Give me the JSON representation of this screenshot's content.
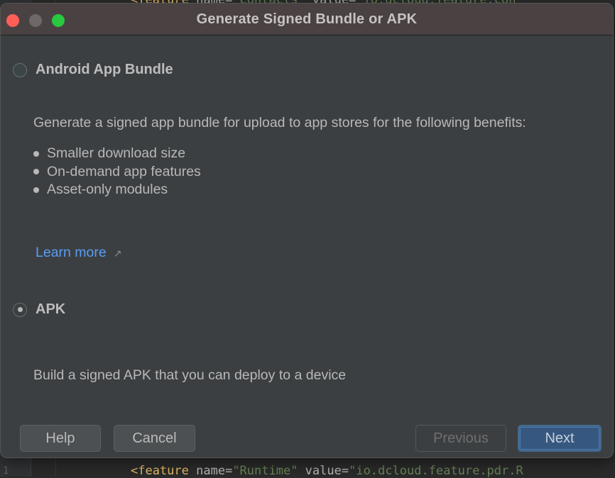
{
  "background_editor": {
    "top_line": {
      "tag": "<feature",
      "attr1": " name=",
      "val1": "\"Contacts\"",
      "attr2": " value=",
      "val2": "\"io.dcloud.feature.con"
    },
    "bottom_line": {
      "line_number": "1",
      "tag": "<feature",
      "attr1": " name=",
      "val1": "\"Runtime\"",
      "attr2": " value=",
      "val2": "\"io.dcloud.feature.pdr.R"
    }
  },
  "dialog": {
    "title": "Generate Signed Bundle or APK",
    "window_controls": [
      "close",
      "minimize",
      "maximize"
    ],
    "options": [
      {
        "id": "android-app-bundle",
        "label": "Android App Bundle",
        "selected": false,
        "description": "Generate a signed app bundle for upload to app stores for the following benefits:",
        "benefits": [
          "Smaller download size",
          "On-demand app features",
          "Asset-only modules"
        ],
        "link": {
          "label": "Learn more",
          "icon": "external-link-arrow-icon",
          "glyph": "↗"
        }
      },
      {
        "id": "apk",
        "label": "APK",
        "selected": true,
        "description": "Build a signed APK that you can deploy to a device"
      }
    ],
    "buttons": {
      "help": "Help",
      "cancel": "Cancel",
      "previous": "Previous",
      "next": "Next"
    },
    "button_states": {
      "previous_enabled": false,
      "next_default": true
    },
    "colors": {
      "link": "#589df6",
      "primary_button": "#365880",
      "close": "#ff5f57",
      "maximize": "#28c840"
    }
  }
}
